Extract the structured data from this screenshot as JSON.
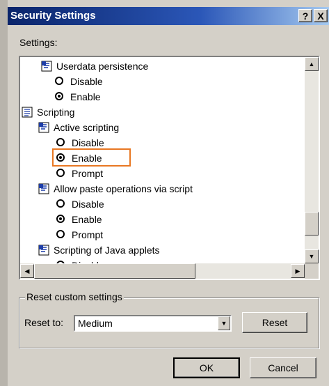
{
  "window": {
    "title": "Security Settings",
    "help_label": "?",
    "close_label": "X"
  },
  "settings": {
    "label": "Settings:",
    "rows": [
      {
        "type": "setting",
        "label": "Userdata persistence",
        "icon": "setting-icon"
      },
      {
        "type": "option",
        "label": "Disable",
        "checked": false
      },
      {
        "type": "option",
        "label": "Enable",
        "checked": true
      },
      {
        "type": "category",
        "label": "Scripting",
        "icon": "category-icon"
      },
      {
        "type": "setting",
        "label": "Active scripting",
        "icon": "setting-icon"
      },
      {
        "type": "option",
        "label": "Disable",
        "checked": false
      },
      {
        "type": "option",
        "label": "Enable",
        "checked": true
      },
      {
        "type": "option",
        "label": "Prompt",
        "checked": false
      },
      {
        "type": "setting",
        "label": "Allow paste operations via script",
        "icon": "setting-icon"
      },
      {
        "type": "option",
        "label": "Disable",
        "checked": false
      },
      {
        "type": "option",
        "label": "Enable",
        "checked": true
      },
      {
        "type": "option",
        "label": "Prompt",
        "checked": false
      },
      {
        "type": "setting",
        "label": "Scripting of Java applets",
        "icon": "setting-icon"
      },
      {
        "type": "option",
        "label": "Disable",
        "checked": false
      }
    ]
  },
  "reset": {
    "group_title": "Reset custom settings",
    "reset_to_label": "Reset to:",
    "selected": "Medium",
    "reset_button": "Reset"
  },
  "footer": {
    "ok": "OK",
    "cancel": "Cancel"
  },
  "colors": {
    "highlight": "#e87722",
    "titlebar": "#0a246a"
  }
}
